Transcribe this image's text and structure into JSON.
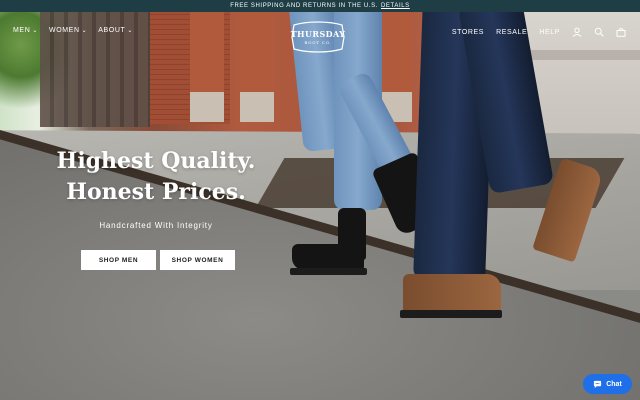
{
  "announcement": {
    "text": "FREE SHIPPING AND RETURNS IN THE U.S.",
    "link": "DETAILS"
  },
  "nav": {
    "left": [
      {
        "label": "MEN",
        "has_dropdown": true
      },
      {
        "label": "WOMEN",
        "has_dropdown": true
      },
      {
        "label": "ABOUT",
        "has_dropdown": true
      }
    ],
    "right": [
      {
        "label": "STORES"
      },
      {
        "label": "RESALE"
      },
      {
        "label": "HELP"
      }
    ],
    "icons": [
      "account-icon",
      "search-icon",
      "cart-icon"
    ]
  },
  "logo": {
    "line1": "THURSDAY",
    "line2": "BOOT CO."
  },
  "hero": {
    "headline_line1": "Highest Quality.",
    "headline_line2": "Honest Prices.",
    "subheading": "Handcrafted With Integrity",
    "cta_men": "SHOP MEN",
    "cta_women": "SHOP WOMEN"
  },
  "chat": {
    "label": "Chat"
  },
  "colors": {
    "announcement_bg": "#1e3d45",
    "chat_bg": "#1f6fe8",
    "button_bg": "#ffffff"
  }
}
